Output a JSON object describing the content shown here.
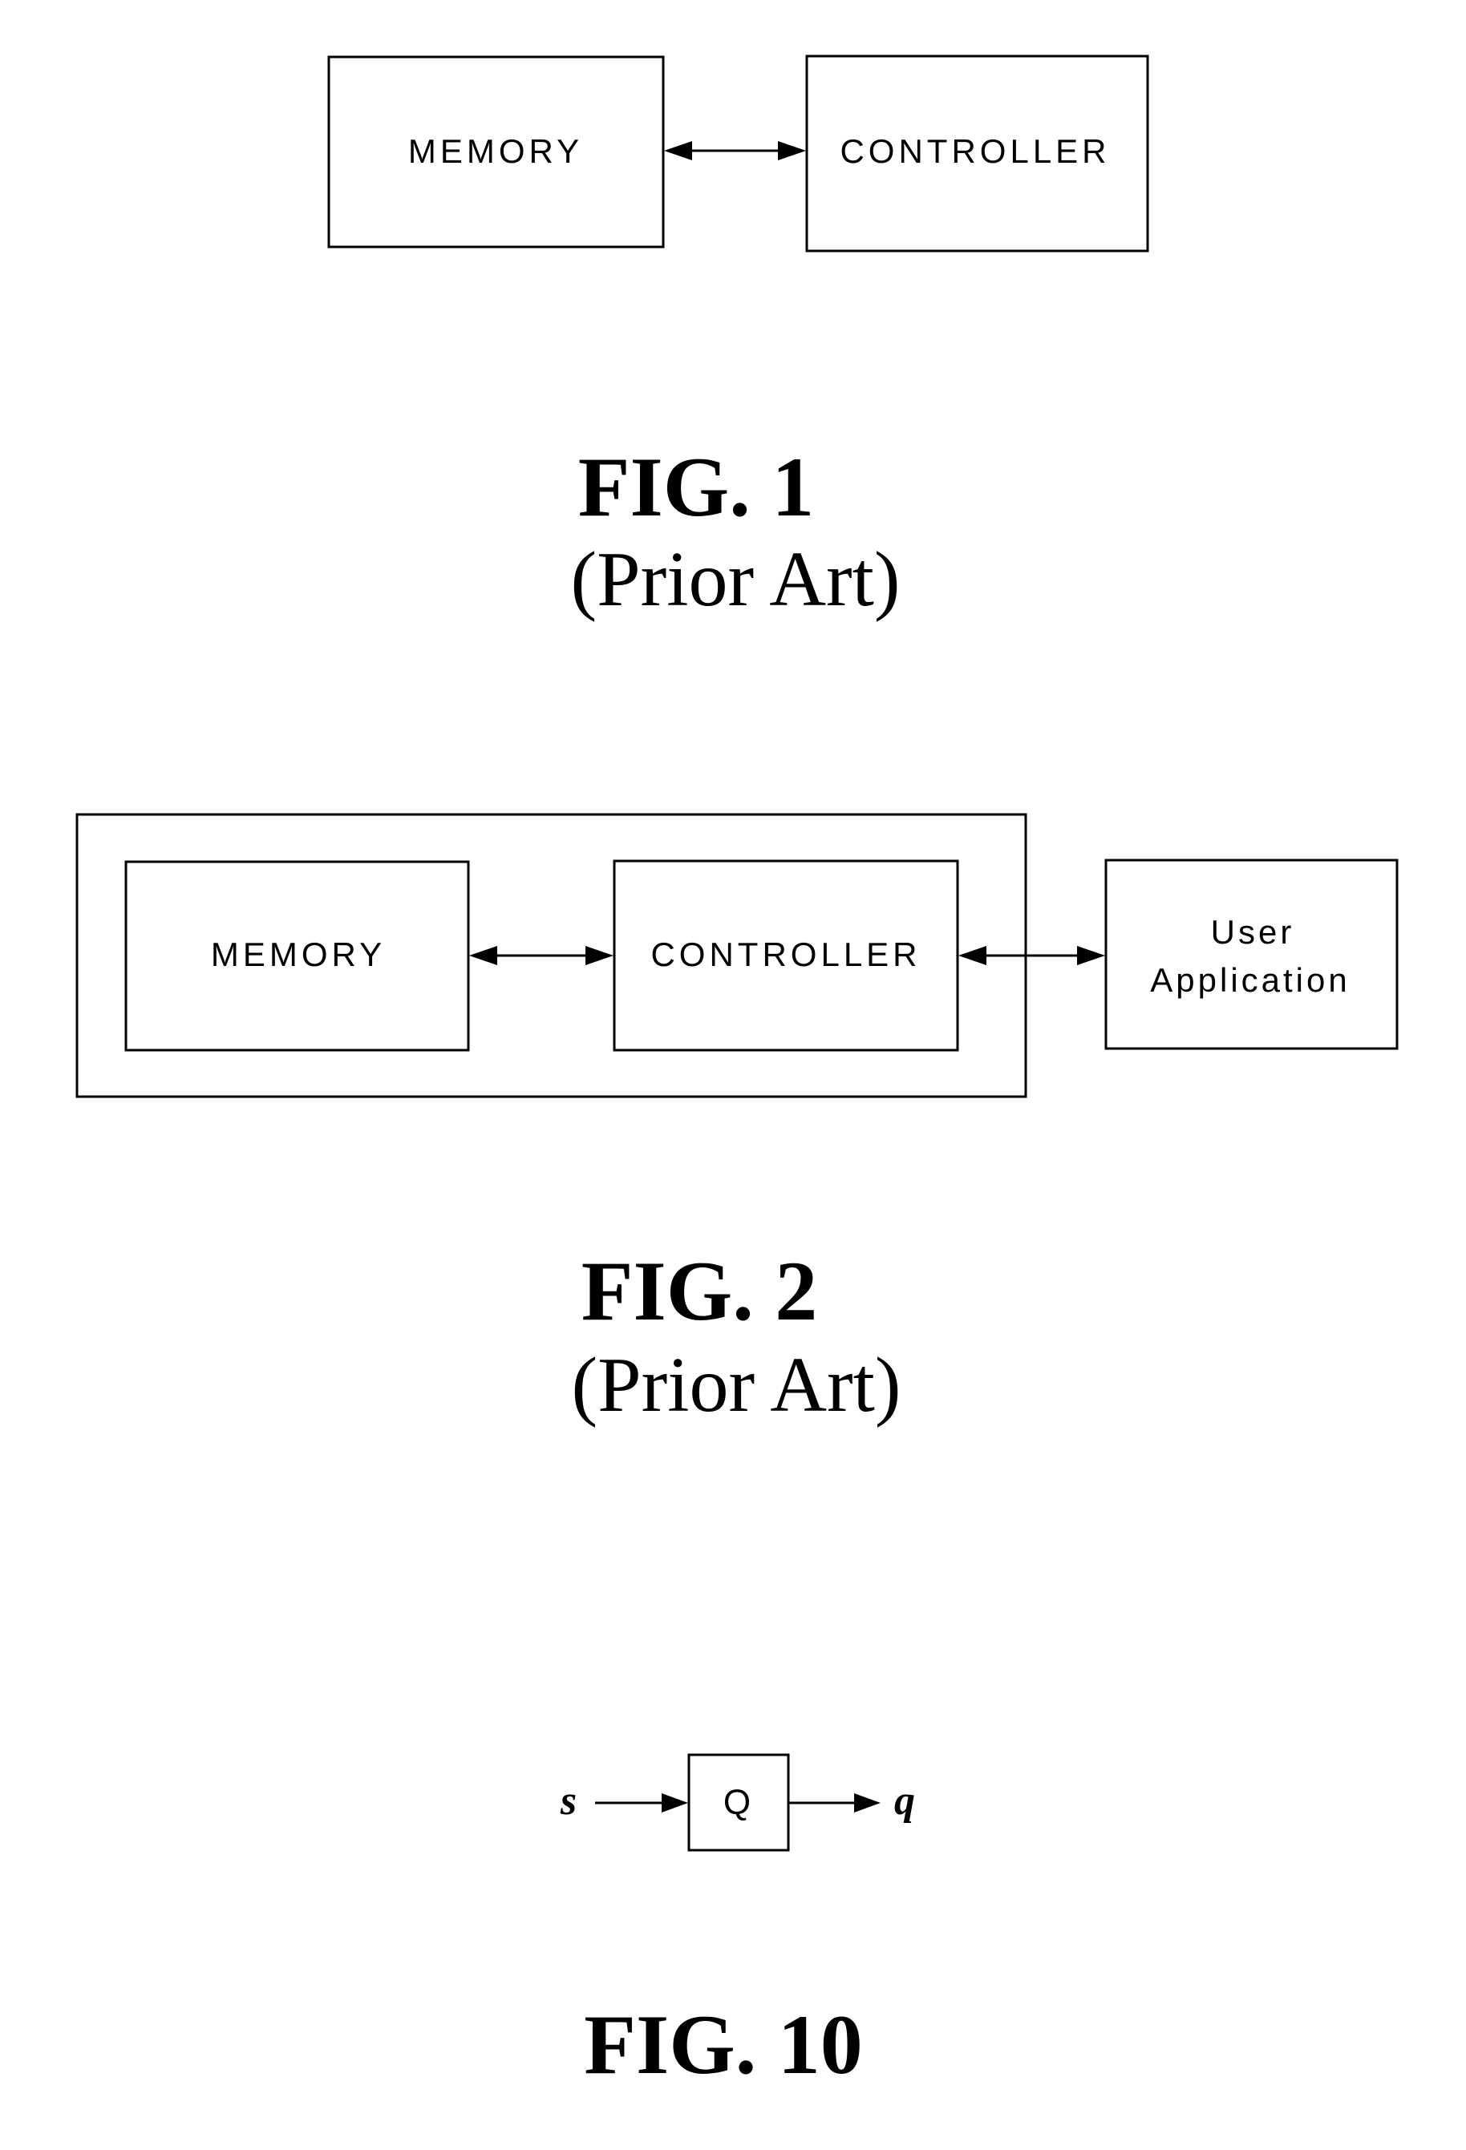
{
  "fig1": {
    "blocks": {
      "memory": "MEMORY",
      "controller": "CONTROLLER"
    },
    "connections": [
      {
        "from": "memory",
        "to": "controller",
        "type": "bidirectional"
      }
    ],
    "caption": "FIG. 1",
    "subcaption": "(Prior Art)"
  },
  "fig2": {
    "blocks": {
      "memory": "MEMORY",
      "controller": "CONTROLLER",
      "user_app_line1": "User",
      "user_app_line2": "Application"
    },
    "grouping": "memory and controller enclosed in an outer box",
    "connections": [
      {
        "from": "memory",
        "to": "controller",
        "type": "bidirectional"
      },
      {
        "from": "controller",
        "to": "user_application",
        "type": "bidirectional"
      }
    ],
    "caption": "FIG. 2",
    "subcaption": "(Prior Art)"
  },
  "fig10": {
    "input": "s",
    "block": "Q",
    "output": "q",
    "connections": [
      {
        "from": "s",
        "to": "Q",
        "type": "directed"
      },
      {
        "from": "Q",
        "to": "q",
        "type": "directed"
      }
    ],
    "caption": "FIG. 10"
  }
}
